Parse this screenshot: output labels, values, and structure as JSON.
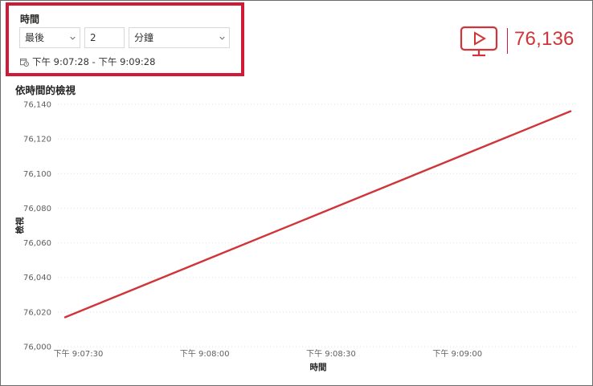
{
  "filter": {
    "title": "時間",
    "relative_mode": "最後",
    "amount": "2",
    "unit": "分鐘",
    "range_text": "下午 9:07:28 - 下午 9:09:28",
    "calendar_icon": "calendar-clock-icon"
  },
  "kpi": {
    "icon": "tv-play-icon",
    "value": "76,136",
    "accent_color": "#d13438"
  },
  "chart": {
    "title": "依時間的檢視"
  },
  "chart_data": {
    "type": "line",
    "title": "依時間的檢視",
    "xlabel": "時間",
    "ylabel": "檢視",
    "x_ticks": [
      "下午 9:07:30",
      "下午 9:08:00",
      "下午 9:08:30",
      "下午 9:09:00"
    ],
    "y_ticks": [
      "76,000",
      "76,020",
      "76,040",
      "76,060",
      "76,080",
      "76,100",
      "76,120",
      "76,140"
    ],
    "ylim": [
      76000,
      76140
    ],
    "xlim_seconds": [
      0,
      120
    ],
    "grid": true,
    "line_color": "#d13438",
    "series": [
      {
        "x": [
          "下午 9:07:28",
          "下午 9:09:28"
        ],
        "values": [
          76017,
          76136
        ]
      }
    ]
  }
}
